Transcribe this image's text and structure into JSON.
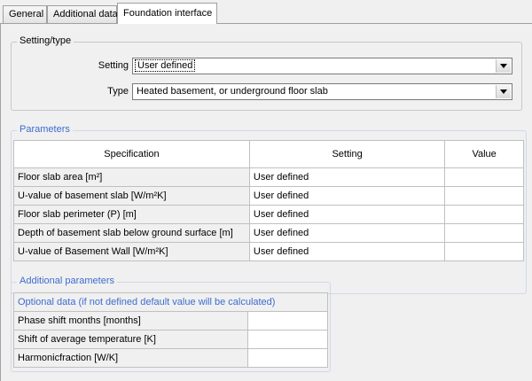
{
  "tabs": [
    {
      "label": "General"
    },
    {
      "label": "Additional data"
    },
    {
      "label": "Foundation interface"
    }
  ],
  "setting_type": {
    "title": "Setting/type",
    "setting_label": "Setting",
    "setting_value": "User defined",
    "type_label": "Type",
    "type_value": "Heated basement, or underground floor slab"
  },
  "parameters": {
    "title": "Parameters",
    "headers": {
      "specification": "Specification",
      "setting": "Setting",
      "value": "Value"
    },
    "rows": [
      {
        "spec": "Floor slab area  [m²]",
        "setting": "User defined",
        "value": ""
      },
      {
        "spec": "U-value of basement slab  [W/m²K]",
        "setting": "User defined",
        "value": ""
      },
      {
        "spec": "Floor slab perimeter (P)  [m]",
        "setting": "User defined",
        "value": ""
      },
      {
        "spec": "Depth of basement slab below ground surface  [m]",
        "setting": "User defined",
        "value": ""
      },
      {
        "spec": "U-value of Basement Wall  [W/m²K]",
        "setting": "User defined",
        "value": ""
      }
    ]
  },
  "additional": {
    "title": "Additional parameters",
    "note": "Optional data (if not defined default value will be calculated)",
    "rows": [
      {
        "spec": "Phase shift months  [months]",
        "value": ""
      },
      {
        "spec": "Shift of average temperature  [K]",
        "value": ""
      },
      {
        "spec": "Harmonicfraction  [W/K]",
        "value": ""
      }
    ]
  },
  "colors": {
    "accent": "#3d6ccf",
    "panel_bg": "#f0f0f0",
    "border": "#c0c0c0"
  },
  "icons": {
    "combo_arrow": "chevron-down-icon"
  }
}
